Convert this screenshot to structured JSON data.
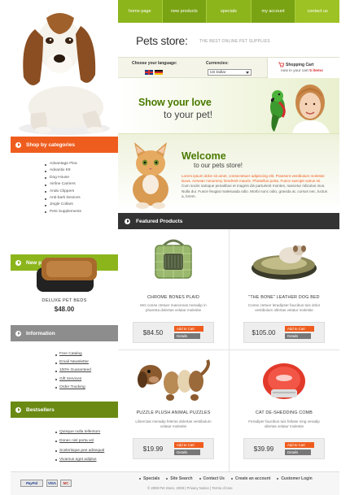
{
  "nav": {
    "items": [
      "home page",
      "new products",
      "specials",
      "my account",
      "contact us"
    ]
  },
  "header": {
    "logo": "Pets store:",
    "tagline": "THE BEST ONLINE PET SUPPLIES"
  },
  "options": {
    "language_label": "Choose your language:",
    "currency_label": "Currencies:",
    "currency_value": "US Dollar",
    "cart_label": "Shopping Cart",
    "cart_text_prefix": "now in your cart",
    "cart_count": "5 items"
  },
  "hero": {
    "line1": "Show your love",
    "line2": "to your pet!"
  },
  "welcome": {
    "title": "Welcome",
    "subtitle": "to our pets store!",
    "text_highlight": "Lorem ipsum dolor sit amet, consectetuer adipiscing elit. Praesent vestibulum molestie lacus. Aenean nonummy hendrerit mauris. Phasellus porta. Fusce suscipit varius mi.",
    "text_rest": "Cum sociis natoque penatibus et magnis dis parturient montes, nascetur ridiculus mus. Nulla dui. Fusce feugiat malesuada odio. Morbi nunc odio, gravida at, cursus nec, luctus a, lorem."
  },
  "sidebar": {
    "categories_title": "Shop by categories",
    "categories": [
      "Advantage Flea",
      "Advantix K9",
      "Dog House",
      "Airline Carriers",
      "Ando Clippers",
      "Anti-bark Devices",
      "Jingle Collars",
      "Pets Supplements"
    ],
    "new_products_title": "New products",
    "new_product_name": "DELUXE PET BEDS",
    "new_product_price": "$48.00",
    "information_title": "Information",
    "information": [
      "Free Catalog",
      "Email Newsletter",
      "100% Guaranteed",
      "Gift Services",
      "Order Tracking"
    ],
    "bestsellers_title": "Bestsellers",
    "bestsellers": [
      "Quisque nulla tellentum",
      "Donec nisl porta vel",
      "Scelerisque pee adsequal",
      "Vivamus eget adiplus"
    ]
  },
  "featured": {
    "title": "Featured Products",
    "add_label": "Add to Cart",
    "details_label": "Details",
    "products": [
      {
        "name": "CHROME BONES PLAID",
        "desc": "Mct conse ctetuer maecenas meradip in pharetra dolertas velatur molestie",
        "price": "$84.50"
      },
      {
        "name": "\"THE BONE\" LEATHER DOG BED",
        "desc": "Conse ctetuer leradipser faucibus tuis dolor vestibulum ollertas velatur molestie",
        "price": "$105.00"
      },
      {
        "name": "PUZZLE PLUSH ANIMAL PUZZLES",
        "desc": "Lilserctas meradip felerse dolertas vestibulum velatur molestie",
        "price": "$19.99"
      },
      {
        "name": "CAT DE-SHEDDING COMB",
        "desc": "Feradiper faucibus tuis feltase ning veradip ollertas velatur molestie",
        "price": "$39.99"
      }
    ]
  },
  "footer": {
    "links": [
      "Specials",
      "Site Search",
      "Contact Us",
      "Create an account",
      "Customer Login"
    ],
    "copyright": "© 2008 Pet Store, 2008 | Privacy Notice | Terms of Use",
    "pay_paypal": "PayPal",
    "pay_visa": "VISA",
    "pay_mc": "MC"
  }
}
